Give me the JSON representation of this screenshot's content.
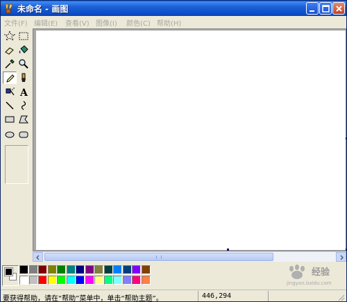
{
  "window": {
    "title": "未命名 - 画图"
  },
  "menubar": {
    "items": [
      {
        "label": "文件(F)"
      },
      {
        "label": "编辑(E)"
      },
      {
        "label": "查看(V)"
      },
      {
        "label": "图像(I)"
      },
      {
        "label": "颜色(C)"
      },
      {
        "label": "帮助(H)"
      }
    ]
  },
  "toolbox": {
    "tools": [
      {
        "name": "free-form-select-icon"
      },
      {
        "name": "rect-select-icon"
      },
      {
        "name": "eraser-icon"
      },
      {
        "name": "fill-bucket-icon"
      },
      {
        "name": "color-picker-icon"
      },
      {
        "name": "magnifier-icon"
      },
      {
        "name": "pencil-icon",
        "selected": true
      },
      {
        "name": "brush-icon"
      },
      {
        "name": "airbrush-icon"
      },
      {
        "name": "text-icon",
        "glyph": "A"
      },
      {
        "name": "line-icon"
      },
      {
        "name": "curve-icon"
      },
      {
        "name": "rectangle-icon"
      },
      {
        "name": "polygon-icon"
      },
      {
        "name": "ellipse-icon"
      },
      {
        "name": "rounded-rect-icon"
      }
    ]
  },
  "colors": {
    "foreground": "#000000",
    "background": "#ffffff",
    "palette_row1": [
      "#000000",
      "#808080",
      "#800000",
      "#808000",
      "#008000",
      "#008080",
      "#000080",
      "#800080",
      "#808040",
      "#004040",
      "#0080ff",
      "#004080",
      "#8000ff",
      "#804000"
    ],
    "palette_row2": [
      "#ffffff",
      "#c0c0c0",
      "#ff0000",
      "#ffff00",
      "#00ff00",
      "#00ffff",
      "#0000ff",
      "#ff00ff",
      "#ffff80",
      "#00ff80",
      "#80ffff",
      "#8080ff",
      "#ff0080",
      "#ff8040"
    ]
  },
  "statusbar": {
    "help_text": "要获得帮助，请在“帮助”菜单中，单击“帮助主题”。",
    "coords": "446,294"
  },
  "watermark": {
    "text": "经验",
    "sub": "jingyan.baidu.com"
  }
}
